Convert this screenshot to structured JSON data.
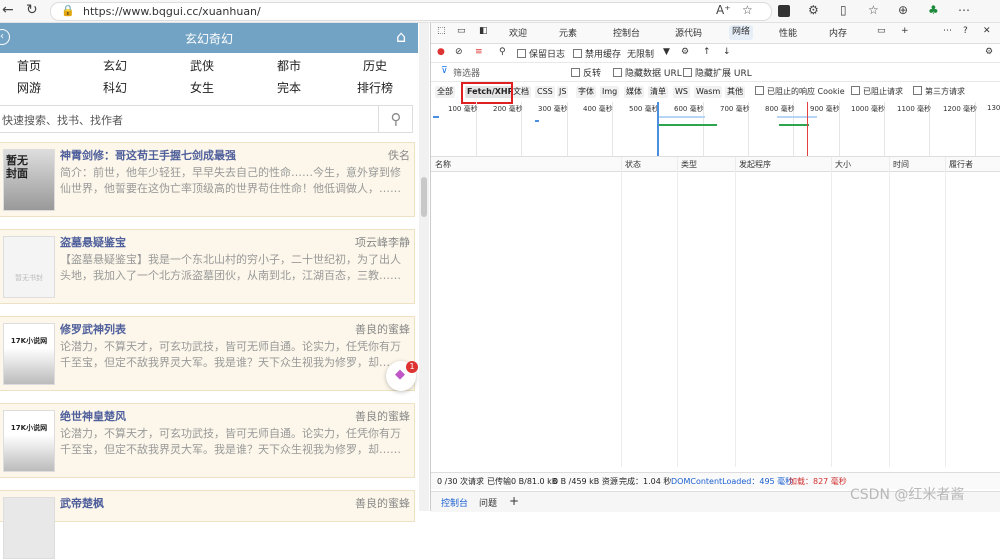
{
  "browser": {
    "url": "https://www.bqgui.cc/xuanhuan/",
    "nav_back": "←",
    "nav_reload": "↻",
    "nav_home": "⌂",
    "lock_icon": "🔒",
    "toolbar_icons": [
      "A⁺",
      "☆",
      "⋯"
    ]
  },
  "site": {
    "title": "玄幻奇幻",
    "categories_row1": [
      "首页",
      "玄幻",
      "武侠",
      "都市",
      "历史"
    ],
    "categories_row2": [
      "网游",
      "科幻",
      "女生",
      "完本",
      "排行榜"
    ],
    "search_placeholder": "快速搜索、找书、找作者",
    "books": [
      {
        "title": "神霄剑修：哥这苟王手握七剑成最强",
        "author": "佚名",
        "desc": "简介：前世，他年少轻狂，早早失去自己的性命……今生，意外穿到修仙世界，他誓要在这伪亡率顶级高的世界苟住性命！他低调做人，……",
        "cover": "暂无封面"
      },
      {
        "title": "盗墓悬疑鉴宝",
        "author": "项云峰李静",
        "desc": "【盗墓悬疑鉴宝】我是一个东北山村的穷小子，二十世纪初，为了出人头地，我加入了一个北方派盗墓团伙，从南到北，江湖百态，三教……",
        "cover": "暂无书封"
      },
      {
        "title": "修罗武神列表",
        "author": "善良的蜜蜂",
        "desc": "论潜力，不算天才，可玄功武技，皆可无师自通。论实力，任凭你有万千至宝，但定不敌我界灵大军。我是谁？天下众生视我为修罗，却……",
        "cover": "17K小说网"
      },
      {
        "title": "绝世神皇楚风",
        "author": "善良的蜜蜂",
        "desc": "论潜力，不算天才，可玄功武技，皆可无师自通。论实力，任凭你有万千至宝，但定不敌我界灵大军。我是谁？天下众生视我为修罗，却……",
        "cover": "17K小说网"
      },
      {
        "title": "武帝楚枫",
        "author": "善良的蜜蜂",
        "desc": "",
        "cover": ""
      }
    ],
    "float_badge": "1"
  },
  "devtools": {
    "tabs": [
      "欢迎",
      "元素",
      "控制台",
      "源代码",
      "网络",
      "性能",
      "内存"
    ],
    "active_tab": "网络",
    "toolbar": {
      "preserve_log": "保留日志",
      "disable_cache": "禁用缓存",
      "throttle": "无限制"
    },
    "filter": {
      "placeholder": "筛选器",
      "invert": "反转",
      "hide_data_url": "隐藏数据 URL",
      "hide_ext_url": "隐藏扩展 URL"
    },
    "type_filters": [
      "全部",
      "Fetch/XHR",
      "文档",
      "CSS",
      "JS",
      "字体",
      "Img",
      "媒体",
      "清单",
      "WS",
      "Wasm",
      "其他"
    ],
    "selected_type": "Fetch/XHR",
    "type_checkboxes": [
      "已阻止的响应 Cookie",
      "已阻止请求",
      "第三方请求"
    ],
    "timeline_ticks": [
      "100 毫秒",
      "200 毫秒",
      "300 毫秒",
      "400 毫秒",
      "500 毫秒",
      "600 毫秒",
      "700 毫秒",
      "800 毫秒",
      "900 毫秒",
      "1000 毫秒",
      "1100 毫秒",
      "1200 毫秒",
      "1300"
    ],
    "columns": [
      "名称",
      "状态",
      "类型",
      "发起程序",
      "大小",
      "时间",
      "履行者"
    ],
    "status_bar": {
      "requests": "0 /30 次请求",
      "transferred": "已传输0 B/81.0 kB",
      "resources": "0 B /459 kB 资源",
      "finish": "完成：1.04 秒",
      "dcl": "DOMContentLoaded：495 毫秒",
      "load": "加载：827 毫秒"
    },
    "drawer_tabs": [
      "控制台",
      "问题",
      "+"
    ]
  },
  "watermark": "CSDN @红米者酱"
}
